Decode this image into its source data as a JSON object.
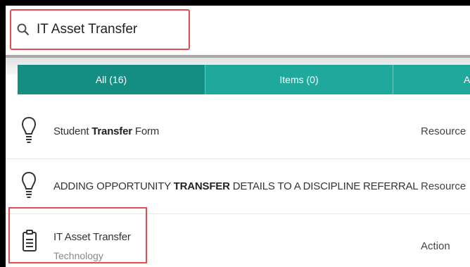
{
  "search": {
    "value": "IT Asset Transfer",
    "placeholder": ""
  },
  "tabs": [
    {
      "label": "All (16)"
    },
    {
      "label": "Items (0)"
    },
    {
      "label": "A"
    }
  ],
  "results": [
    {
      "icon": "lightbulb-icon",
      "title_pre": "Student ",
      "title_bold": "Transfer",
      "title_post": " Form",
      "type": "Resource"
    },
    {
      "icon": "lightbulb-icon",
      "title_pre": "ADDING OPPORTUNITY ",
      "title_bold": "TRANSFER",
      "title_post": " DETAILS TO A DISCIPLINE REFERRAL",
      "type": "Resource"
    },
    {
      "icon": "clipboard-icon",
      "title": "IT Asset Transfer",
      "subtitle": "Technology",
      "type": "Action"
    }
  ],
  "colors": {
    "tab_active": "#148e83",
    "tab_inactive": "#1fa99c",
    "highlight": "#e34b50"
  }
}
